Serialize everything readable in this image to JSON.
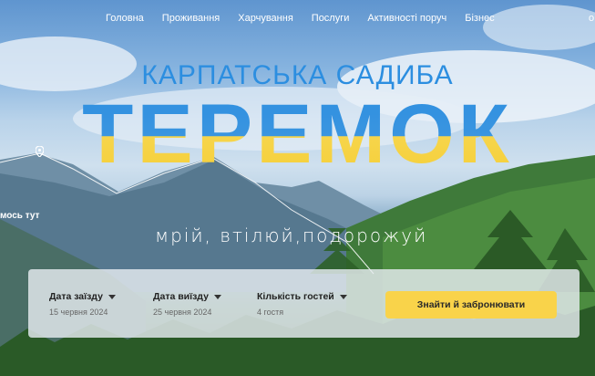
{
  "nav": {
    "items": [
      {
        "label": "Головна"
      },
      {
        "label": "Проживання"
      },
      {
        "label": "Харчування"
      },
      {
        "label": "Послуги"
      },
      {
        "label": "Активності поруч"
      },
      {
        "label": "Бізнес"
      }
    ],
    "cut_label": "о"
  },
  "hero": {
    "subtitle": "КАРПАТСЬКА САДИБА",
    "title": "ТЕРЕМОК",
    "tagline": "мрій, втілюй,подорожуй",
    "marker_label": "мось тут"
  },
  "booking": {
    "checkin": {
      "label": "Дата заїзду",
      "value": "15 червня 2024"
    },
    "checkout": {
      "label": "Дата виїзду",
      "value": "25 червня 2024"
    },
    "guests": {
      "label": "Кількість гостей",
      "value": "4 гостя"
    },
    "submit_label": "Знайти й забронювати"
  },
  "colors": {
    "accent_blue": "#2c8ee0",
    "accent_yellow": "#f9d34a"
  },
  "icons": [
    "location-pin-icon",
    "chevron-down-icon"
  ]
}
